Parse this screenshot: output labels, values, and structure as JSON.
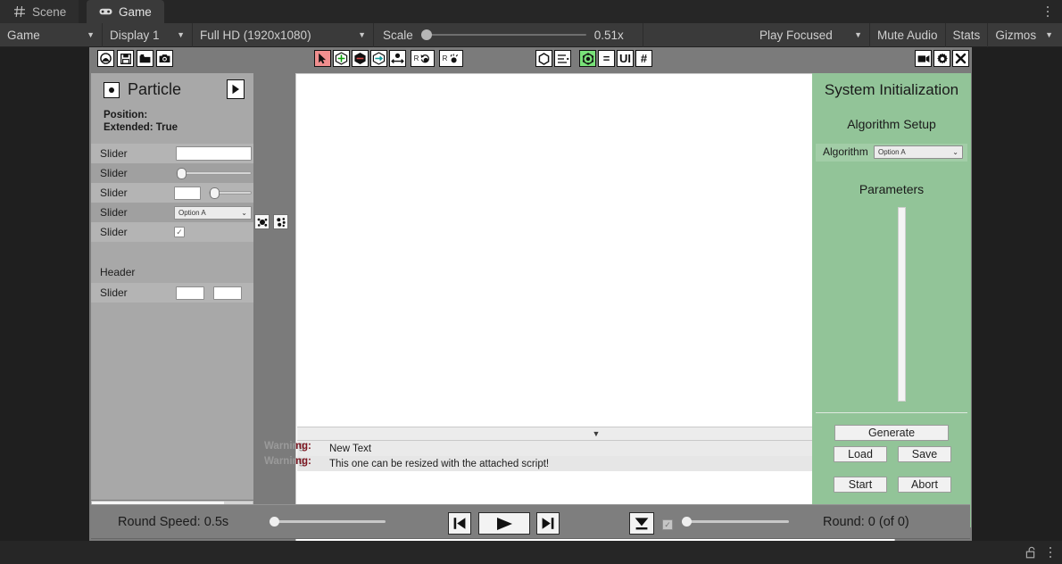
{
  "window": {
    "tabs": [
      {
        "label": "Scene",
        "icon": "grid-icon",
        "active": false
      },
      {
        "label": "Game",
        "icon": "gamepad-icon",
        "active": true
      }
    ]
  },
  "toolbar": {
    "target_label": "Game",
    "display_label": "Display 1",
    "resolution_label": "Full HD (1920x1080)",
    "scale_label": "Scale",
    "scale_value": "0.51x",
    "play_focused_label": "Play Focused",
    "mute_audio_label": "Mute Audio",
    "stats_label": "Stats",
    "gizmos_label": "Gizmos"
  },
  "game_toolbar": {
    "left_icons": [
      "home-icon",
      "save-icon",
      "folder-icon",
      "camera-icon"
    ],
    "tool_icons": [
      "cursor-icon",
      "move-icon",
      "rotate-icon",
      "scale-icon",
      "anchor-icon"
    ],
    "rotate_buttons": [
      {
        "prefix": "R",
        "icon": "rotate-left-icon"
      },
      {
        "prefix": "R",
        "icon": "rotate-right-icon"
      }
    ],
    "view_icons": [
      "hexagon-icon",
      "list-icon",
      "snap-icon",
      "equals-icon",
      "ui-icon",
      "grid-hash-icon"
    ],
    "right_icons": [
      "video-camera-icon",
      "gear-icon",
      "close-icon"
    ]
  },
  "left_panel": {
    "title": "Particle",
    "expand_icon": "play-triangle-icon",
    "info_lines": [
      "Position:",
      "Extended: True"
    ],
    "rows": [
      {
        "label": "Slider",
        "control": "textfield"
      },
      {
        "label": "Slider",
        "control": "slider"
      },
      {
        "label": "Slider",
        "control": "field-plus-slider"
      },
      {
        "label": "Slider",
        "control": "dropdown",
        "value": "Option A"
      },
      {
        "label": "Slider",
        "control": "checkbox",
        "checked": true
      }
    ],
    "header_label": "Header",
    "footer_row": {
      "label": "Slider",
      "control": "two-fields"
    },
    "side_buttons": [
      "particle-burst-icon",
      "particle-scatter-icon"
    ]
  },
  "center_panel": {
    "collapse_icon": "chevron-down-icon",
    "save_icon": "floppy-icon",
    "log_rows": [
      {
        "prefix": "Warning:",
        "message": "New Text"
      },
      {
        "prefix": "Warning:",
        "message": "This one can be resized with the attached script!"
      }
    ]
  },
  "right_panel": {
    "title": "System Initialization",
    "subtitle": "Algorithm Setup",
    "algorithm_label": "Algorithm",
    "algorithm_value": "Option A",
    "parameters_label": "Parameters",
    "buttons": {
      "generate": "Generate",
      "load": "Load",
      "save": "Save",
      "start": "Start",
      "abort": "Abort"
    }
  },
  "playback_bar": {
    "speed_label": "Round Speed: 0.5s",
    "prev_icon": "skip-previous-icon",
    "play_icon": "play-icon",
    "next_icon": "skip-next-icon",
    "download_icon": "download-icon",
    "round_label": "Round: 0 (of 0)"
  },
  "status_bar": {
    "icons": [
      "unlock-icon",
      "kebab-menu-icon"
    ]
  },
  "colors": {
    "panel_green": "#92c498",
    "editor_dark": "#262626",
    "game_gray": "#7b7b7b",
    "warning_red": "#7d1520",
    "accent_selected": "#f08f8f",
    "accent_active": "#79e279"
  }
}
